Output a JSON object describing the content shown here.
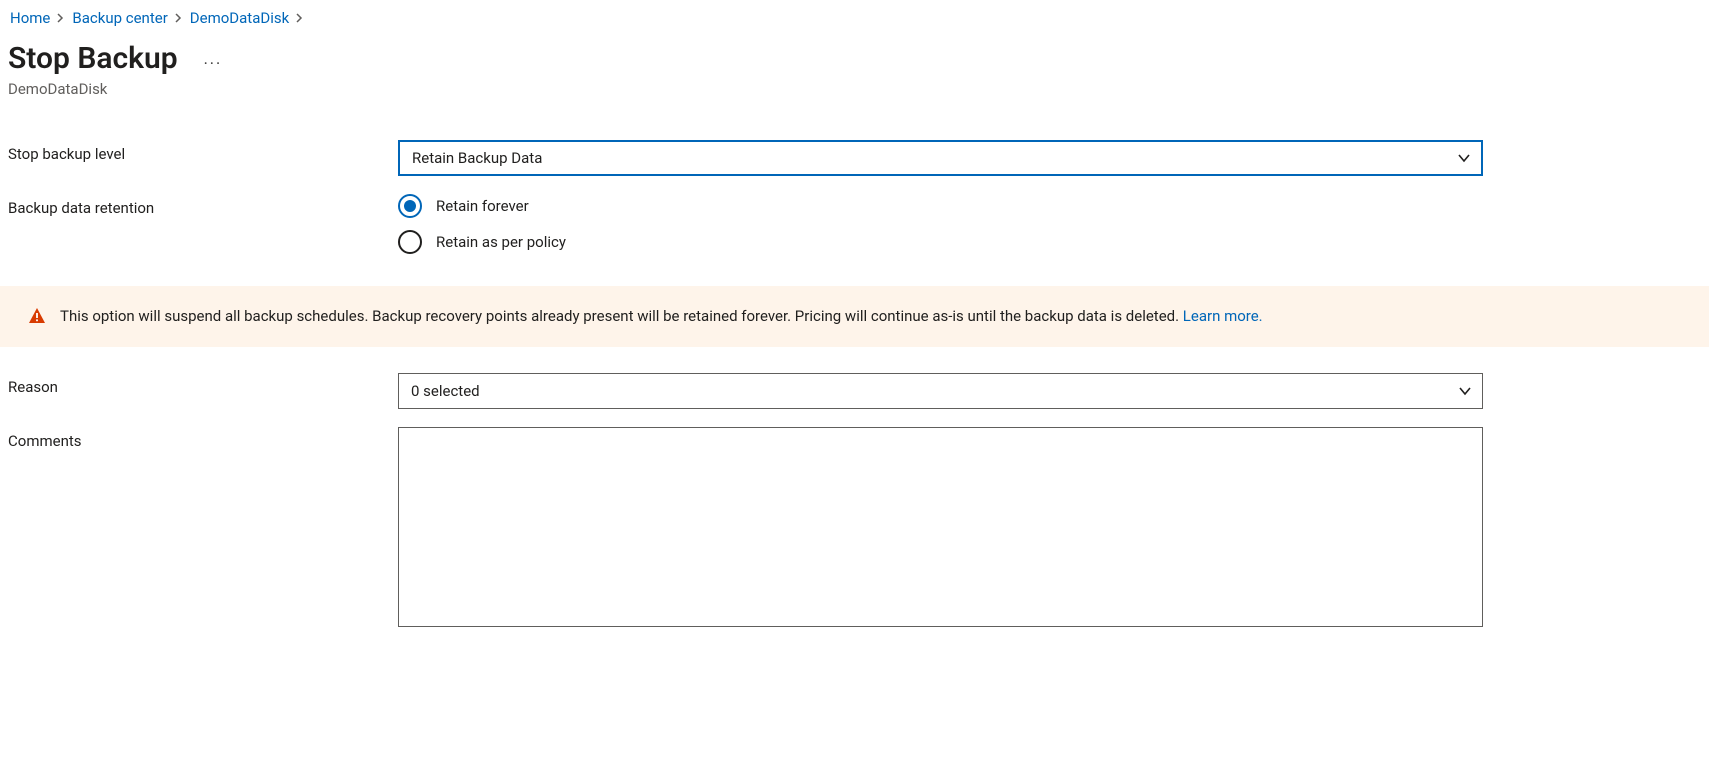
{
  "breadcrumb": {
    "items": [
      {
        "label": "Home"
      },
      {
        "label": "Backup center"
      },
      {
        "label": "DemoDataDisk"
      }
    ]
  },
  "page": {
    "title": "Stop Backup",
    "subtitle": "DemoDataDisk"
  },
  "form": {
    "stop_backup_level": {
      "label": "Stop backup level",
      "value": "Retain Backup Data"
    },
    "retention": {
      "label": "Backup data retention",
      "options": [
        {
          "label": "Retain forever",
          "selected": true
        },
        {
          "label": "Retain as per policy",
          "selected": false
        }
      ]
    },
    "reason": {
      "label": "Reason",
      "value": "0 selected"
    },
    "comments": {
      "label": "Comments",
      "value": ""
    }
  },
  "info": {
    "text": "This option will suspend all backup schedules. Backup recovery points already present will be retained forever. Pricing will continue as-is until the backup data is deleted. ",
    "link_label": "Learn more."
  }
}
